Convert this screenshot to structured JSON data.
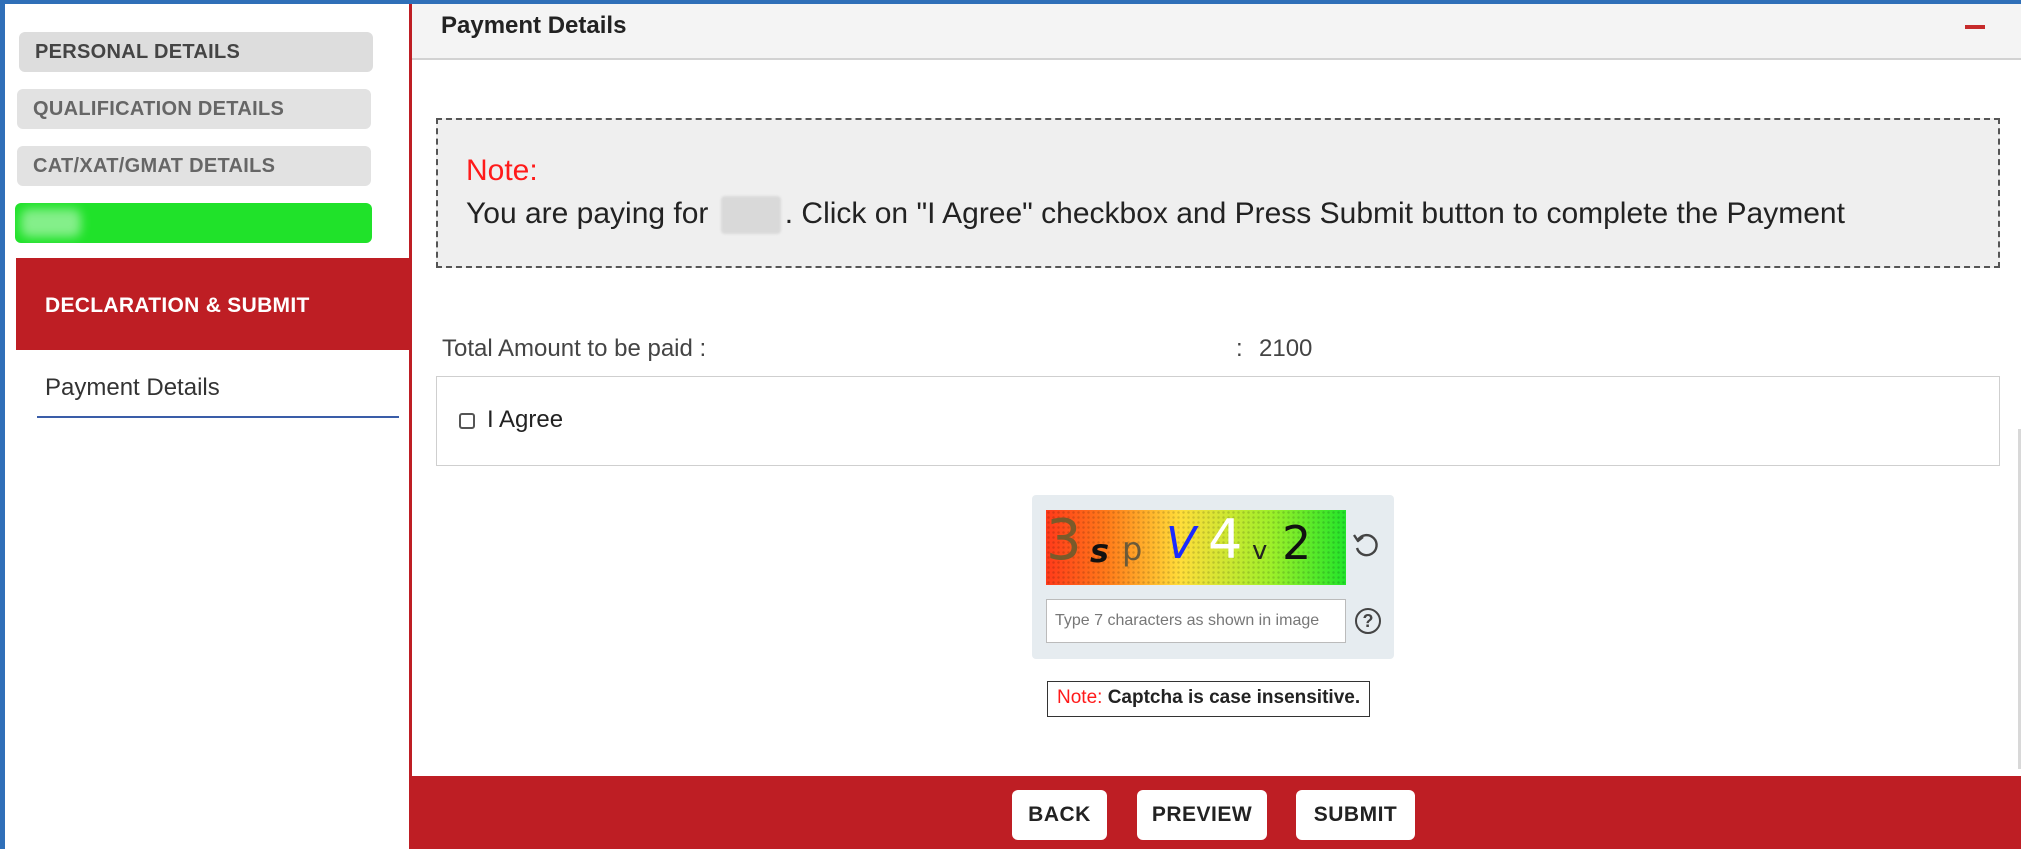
{
  "sidebar": {
    "items": [
      {
        "label": "PERSONAL DETAILS"
      },
      {
        "label": "QUALIFICATION DETAILS"
      },
      {
        "label": "CAT/XAT/GMAT DETAILS"
      }
    ],
    "active_section": "DECLARATION & SUBMIT",
    "sub_item": "Payment Details"
  },
  "main": {
    "title": "Payment Details",
    "note": {
      "title": "Note:",
      "text_before": "You are paying for",
      "text_after": ". Click on \"I Agree\" checkbox and Press Submit button to complete the Payment"
    },
    "amount": {
      "label": "Total Amount to be paid :",
      "separator": ":",
      "value": "2100"
    },
    "agree": {
      "label": "I Agree",
      "checked": false
    },
    "captcha": {
      "characters": [
        "3",
        "s",
        "p",
        "V",
        "4",
        "v",
        "2"
      ],
      "placeholder": "Type 7 characters as shown in image",
      "value": "",
      "note_prefix": "Note:",
      "note_text": "Captcha is case insensitive."
    },
    "buttons": {
      "back": "BACK",
      "preview": "PREVIEW",
      "submit": "SUBMIT"
    }
  },
  "colors": {
    "accent_red": "#be1e24",
    "note_red": "#ff1a1a",
    "progress_green": "#20e22a",
    "frame_blue": "#2f6fb8"
  },
  "icons": [
    "collapse-icon",
    "refresh-icon",
    "help-icon"
  ]
}
